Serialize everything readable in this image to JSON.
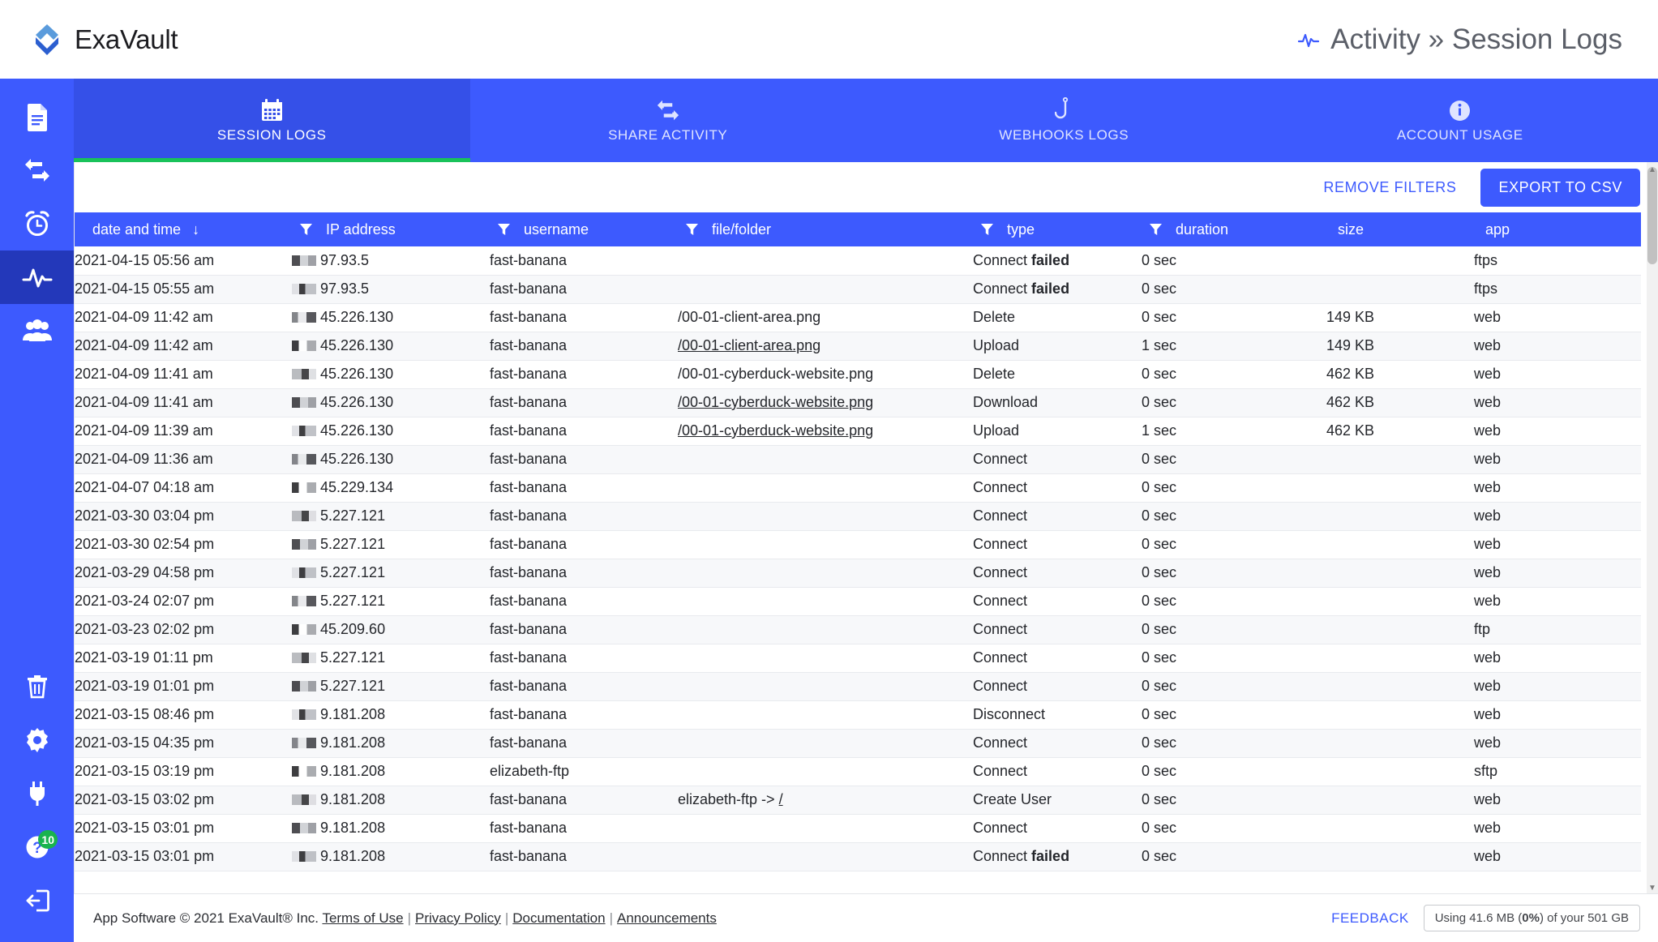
{
  "brand": {
    "name": "ExaVault",
    "logo_icon": "exavault-diamond-logo"
  },
  "header": {
    "title": "Activity » Session Logs",
    "icon": "activity-pulse-icon"
  },
  "sidebar": {
    "top_items": [
      {
        "name": "files",
        "icon": "file-document-icon",
        "active": false
      },
      {
        "name": "share",
        "icon": "transfer-share-icon",
        "active": false
      },
      {
        "name": "scheduled",
        "icon": "alarm-clock-icon",
        "active": false
      },
      {
        "name": "activity",
        "icon": "activity-pulse-icon",
        "active": true
      },
      {
        "name": "users",
        "icon": "users-group-icon",
        "active": false
      }
    ],
    "bottom_items": [
      {
        "name": "trash",
        "icon": "trash-icon",
        "badge": ""
      },
      {
        "name": "settings",
        "icon": "gear-icon",
        "badge": ""
      },
      {
        "name": "integrations",
        "icon": "plug-icon",
        "badge": ""
      },
      {
        "name": "help",
        "icon": "question-mark-icon",
        "badge": "10"
      },
      {
        "name": "logout",
        "icon": "logout-icon",
        "badge": ""
      }
    ]
  },
  "tabs": [
    {
      "label": "SESSION LOGS",
      "icon": "calendar-icon",
      "active": true
    },
    {
      "label": "SHARE ACTIVITY",
      "icon": "transfer-share-icon",
      "active": false
    },
    {
      "label": "WEBHOOKS LOGS",
      "icon": "hook-icon",
      "active": false
    },
    {
      "label": "ACCOUNT USAGE",
      "icon": "info-circle-icon",
      "active": false
    }
  ],
  "toolbar": {
    "remove_filters_label": "REMOVE FILTERS",
    "export_label": "EXPORT TO CSV"
  },
  "table": {
    "columns": [
      {
        "key": "date",
        "label": "date and time",
        "sort": "↓",
        "filter": false
      },
      {
        "key": "ip",
        "label": "IP address",
        "sort": "",
        "filter": true
      },
      {
        "key": "user",
        "label": "username",
        "sort": "",
        "filter": true
      },
      {
        "key": "file",
        "label": "file/folder",
        "sort": "",
        "filter": true
      },
      {
        "key": "type",
        "label": "type",
        "sort": "",
        "filter": true
      },
      {
        "key": "dur",
        "label": "duration",
        "sort": "",
        "filter": true
      },
      {
        "key": "size",
        "label": "size",
        "sort": "",
        "filter": false
      },
      {
        "key": "app",
        "label": "app",
        "sort": "",
        "filter": false
      }
    ],
    "rows": [
      {
        "date": "2021-04-15 05:56 am",
        "ip": "97.93.5",
        "user": "fast-banana",
        "file": "",
        "file_link": false,
        "type": "Connect",
        "type_extra": "failed",
        "dur": "0 sec",
        "size": "",
        "app": "ftps"
      },
      {
        "date": "2021-04-15 05:55 am",
        "ip": "97.93.5",
        "user": "fast-banana",
        "file": "",
        "file_link": false,
        "type": "Connect",
        "type_extra": "failed",
        "dur": "0 sec",
        "size": "",
        "app": "ftps"
      },
      {
        "date": "2021-04-09 11:42 am",
        "ip": "45.226.130",
        "user": "fast-banana",
        "file": "/00-01-client-area.png",
        "file_link": false,
        "type": "Delete",
        "type_extra": "",
        "dur": "0 sec",
        "size": "149 KB",
        "app": "web"
      },
      {
        "date": "2021-04-09 11:42 am",
        "ip": "45.226.130",
        "user": "fast-banana",
        "file": "/00-01-client-area.png",
        "file_link": true,
        "type": "Upload",
        "type_extra": "",
        "dur": "1 sec",
        "size": "149 KB",
        "app": "web"
      },
      {
        "date": "2021-04-09 11:41 am",
        "ip": "45.226.130",
        "user": "fast-banana",
        "file": "/00-01-cyberduck-website.png",
        "file_link": false,
        "type": "Delete",
        "type_extra": "",
        "dur": "0 sec",
        "size": "462 KB",
        "app": "web"
      },
      {
        "date": "2021-04-09 11:41 am",
        "ip": "45.226.130",
        "user": "fast-banana",
        "file": "/00-01-cyberduck-website.png",
        "file_link": true,
        "type": "Download",
        "type_extra": "",
        "dur": "0 sec",
        "size": "462 KB",
        "app": "web"
      },
      {
        "date": "2021-04-09 11:39 am",
        "ip": "45.226.130",
        "user": "fast-banana",
        "file": "/00-01-cyberduck-website.png",
        "file_link": true,
        "type": "Upload",
        "type_extra": "",
        "dur": "1 sec",
        "size": "462 KB",
        "app": "web"
      },
      {
        "date": "2021-04-09 11:36 am",
        "ip": "45.226.130",
        "user": "fast-banana",
        "file": "",
        "file_link": false,
        "type": "Connect",
        "type_extra": "",
        "dur": "0 sec",
        "size": "",
        "app": "web"
      },
      {
        "date": "2021-04-07 04:18 am",
        "ip": "45.229.134",
        "user": "fast-banana",
        "file": "",
        "file_link": false,
        "type": "Connect",
        "type_extra": "",
        "dur": "0 sec",
        "size": "",
        "app": "web"
      },
      {
        "date": "2021-03-30 03:04 pm",
        "ip": "5.227.121",
        "user": "fast-banana",
        "file": "",
        "file_link": false,
        "type": "Connect",
        "type_extra": "",
        "dur": "0 sec",
        "size": "",
        "app": "web"
      },
      {
        "date": "2021-03-30 02:54 pm",
        "ip": "5.227.121",
        "user": "fast-banana",
        "file": "",
        "file_link": false,
        "type": "Connect",
        "type_extra": "",
        "dur": "0 sec",
        "size": "",
        "app": "web"
      },
      {
        "date": "2021-03-29 04:58 pm",
        "ip": "5.227.121",
        "user": "fast-banana",
        "file": "",
        "file_link": false,
        "type": "Connect",
        "type_extra": "",
        "dur": "0 sec",
        "size": "",
        "app": "web"
      },
      {
        "date": "2021-03-24 02:07 pm",
        "ip": "5.227.121",
        "user": "fast-banana",
        "file": "",
        "file_link": false,
        "type": "Connect",
        "type_extra": "",
        "dur": "0 sec",
        "size": "",
        "app": "web"
      },
      {
        "date": "2021-03-23 02:02 pm",
        "ip": "45.209.60",
        "user": "fast-banana",
        "file": "",
        "file_link": false,
        "type": "Connect",
        "type_extra": "",
        "dur": "0 sec",
        "size": "",
        "app": "ftp"
      },
      {
        "date": "2021-03-19 01:11 pm",
        "ip": "5.227.121",
        "user": "fast-banana",
        "file": "",
        "file_link": false,
        "type": "Connect",
        "type_extra": "",
        "dur": "0 sec",
        "size": "",
        "app": "web"
      },
      {
        "date": "2021-03-19 01:01 pm",
        "ip": "5.227.121",
        "user": "fast-banana",
        "file": "",
        "file_link": false,
        "type": "Connect",
        "type_extra": "",
        "dur": "0 sec",
        "size": "",
        "app": "web"
      },
      {
        "date": "2021-03-15 08:46 pm",
        "ip": "9.181.208",
        "user": "fast-banana",
        "file": "",
        "file_link": false,
        "type": "Disconnect",
        "type_extra": "",
        "dur": "0 sec",
        "size": "",
        "app": "web"
      },
      {
        "date": "2021-03-15 04:35 pm",
        "ip": "9.181.208",
        "user": "fast-banana",
        "file": "",
        "file_link": false,
        "type": "Connect",
        "type_extra": "",
        "dur": "0 sec",
        "size": "",
        "app": "web"
      },
      {
        "date": "2021-03-15 03:19 pm",
        "ip": "9.181.208",
        "user": "elizabeth-ftp",
        "file": "",
        "file_link": false,
        "type": "Connect",
        "type_extra": "",
        "dur": "0 sec",
        "size": "",
        "app": "sftp"
      },
      {
        "date": "2021-03-15 03:02 pm",
        "ip": "9.181.208",
        "user": "fast-banana",
        "file": "elizabeth-ftp -> /",
        "file_link": false,
        "file_link_tail": "/",
        "file_prefix": "elizabeth-ftp -> ",
        "type": "Create User",
        "type_extra": "",
        "dur": "0 sec",
        "size": "",
        "app": "web"
      },
      {
        "date": "2021-03-15 03:01 pm",
        "ip": "9.181.208",
        "user": "fast-banana",
        "file": "",
        "file_link": false,
        "type": "Connect",
        "type_extra": "",
        "dur": "0 sec",
        "size": "",
        "app": "web"
      },
      {
        "date": "2021-03-15 03:01 pm",
        "ip": "9.181.208",
        "user": "fast-banana",
        "file": "",
        "file_link": false,
        "type": "Connect",
        "type_extra": "failed",
        "dur": "0 sec",
        "size": "",
        "app": "web"
      }
    ]
  },
  "footer": {
    "copyright": "App Software © 2021 ExaVault® Inc.",
    "links": [
      "Terms of Use",
      "Privacy Policy",
      "Documentation",
      "Announcements"
    ],
    "feedback_label": "FEEDBACK",
    "quota_prefix": "Using 41.6 MB (",
    "quota_percent": "0%",
    "quota_suffix": ") of your 501 GB"
  },
  "colors": {
    "brand_blue": "#3d5afe",
    "tab_active_blue": "#3550e8",
    "rail_active_blue": "#2338ba",
    "accent_green": "#19c25a",
    "badge_green": "#19b34f"
  }
}
